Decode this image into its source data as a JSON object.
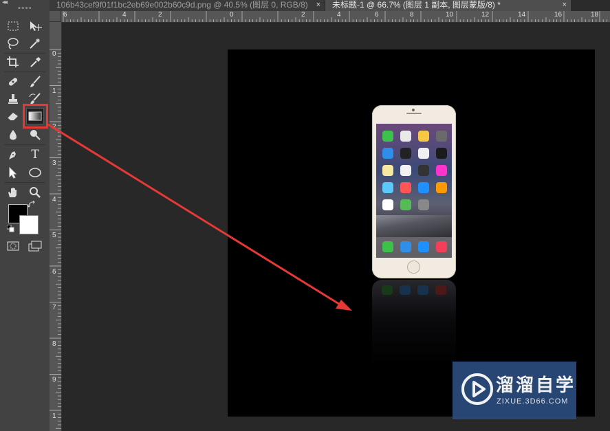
{
  "document_tabs": [
    {
      "title": "106b43cef9f01f1bc2eb69e002b60c9d.png @ 40.5% (图层 0, RGB/8)",
      "close": "×"
    },
    {
      "title": "未标题-1 @ 66.7% (图层 1 副本, 图层蒙版/8) *",
      "close": "×"
    }
  ],
  "ruler_top": [
    "6",
    "4",
    "2",
    "0",
    "2",
    "4",
    "6",
    "8",
    "10",
    "12",
    "14",
    "16",
    "18"
  ],
  "ruler_left": [
    "0",
    "1",
    "2",
    "3",
    "4",
    "5",
    "6",
    "7",
    "8",
    "9",
    "1"
  ],
  "colors": {
    "foreground": "#000000",
    "background": "#ffffff",
    "highlight": "#e53935",
    "arrow": "#e53935"
  },
  "toolbar": {
    "collapse_glyph": "◂◂",
    "tools": [
      "rectangular-marquee",
      "move",
      "lasso",
      "magic-wand",
      "crop",
      "eyedropper",
      "healing-brush",
      "brush",
      "clone-stamp",
      "history-brush",
      "eraser",
      "gradient",
      "blur",
      "dodge",
      "pen",
      "type",
      "path-selection",
      "ellipse",
      "hand",
      "zoom",
      "quick-mask",
      "screen-mode"
    ],
    "selected_tool": "gradient",
    "type_glyph": "T"
  },
  "watermark": {
    "name": "溜溜自学",
    "url": "ZIXUE.3D66.COM"
  }
}
